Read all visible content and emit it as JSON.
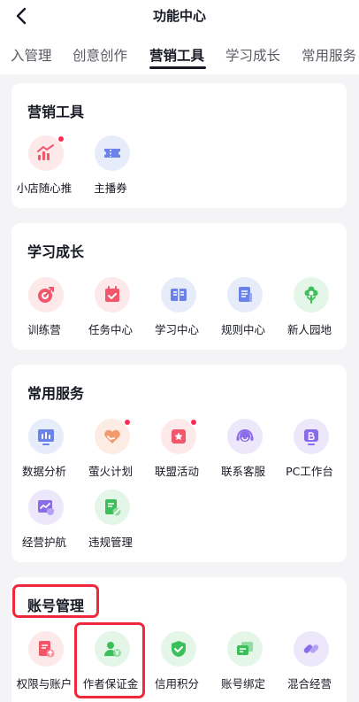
{
  "header": {
    "title": "功能中心"
  },
  "tabs": [
    "入管理",
    "创意创作",
    "营销工具",
    "学习成长",
    "常用服务"
  ],
  "sections": {
    "marketing": {
      "title": "营销工具",
      "items": [
        "小店随心推",
        "主播券"
      ]
    },
    "learning": {
      "title": "学习成长",
      "items": [
        "训练营",
        "任务中心",
        "学习中心",
        "规则中心",
        "新人园地"
      ]
    },
    "common": {
      "title": "常用服务",
      "items": [
        "数据分析",
        "萤火计划",
        "联盟活动",
        "联系客服",
        "PC工作台",
        "经营护航",
        "违规管理"
      ]
    },
    "account": {
      "title": "账号管理",
      "items": [
        "权限与账户",
        "作者保证金",
        "信用积分",
        "账号绑定",
        "混合经营"
      ]
    }
  },
  "colors": {
    "highlight": "#f0283c",
    "badge": "#fe2c55",
    "active_tab": "#161823"
  }
}
